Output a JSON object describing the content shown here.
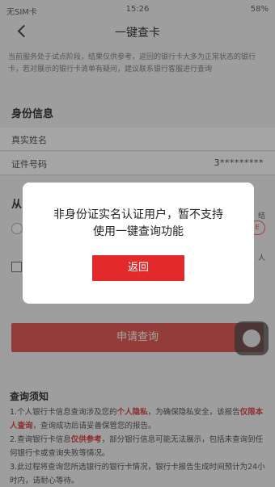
{
  "status_bar": {
    "carrier": "无SIM卡",
    "time": "15:26",
    "battery": "58%"
  },
  "nav": {
    "title": "一键查卡"
  },
  "notice": "当前服务处于试点阶段，结果仅供参考，返回的银行卡大多为正常状态的银行卡，若对展示的银行卡清单有疑问，建议联系银行客服进行查询",
  "identity": {
    "section_title": "身份信息",
    "name_label": "真实姓名",
    "id_label": "证件号码",
    "id_value": "3*********"
  },
  "from_label": "从",
  "side_texts": [
    "结",
    "人",
    "E"
  ],
  "apply_button": "申请查询",
  "tips": {
    "title": "查询须知",
    "item1_a": "1.个人银行卡信息查询涉及您的",
    "item1_b": "个人隐私",
    "item1_c": "，为确保隐私安全，该报告",
    "item1_d": "仅限本人查询",
    "item1_e": "，查询成功后请妥善保管您的报告。",
    "item2_a": "2.查询银行卡信息",
    "item2_b": "仅供参考",
    "item2_c": "，部分银行信息可能无法展示，包括未查询到任何银行卡或查询失败等情况。",
    "item3": "3.此过程将查询您所选银行的银行卡情况，银行卡报告生成时间预计为24小时内，请耐心等待。"
  },
  "dialog": {
    "message_line1": "非身份证实名认证用户，暂不支持",
    "message_line2": "使用一键查询功能",
    "button": "返回"
  }
}
